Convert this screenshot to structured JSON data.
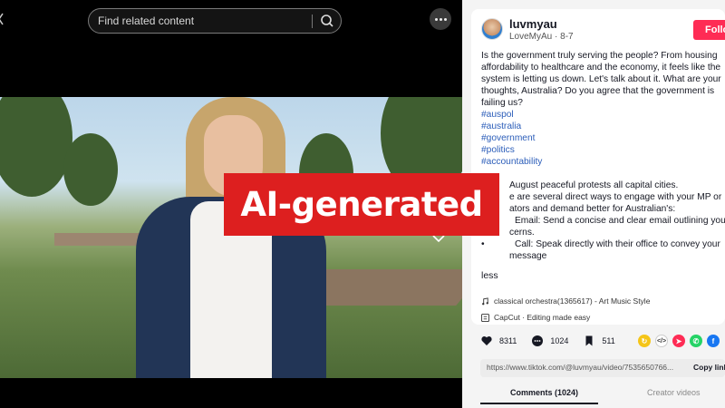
{
  "search": {
    "placeholder": "Find related content"
  },
  "overlay": {
    "badge_text": "AI-generated"
  },
  "post": {
    "username": "luvmyau",
    "handle_date": "LoveMyAu · 8-7",
    "follow_label": "Follow",
    "caption": "Is the government truly serving the people? From housing affordability to healthcare and the economy, it feels like the system is letting us down. Let's talk about it. What are your thoughts, Australia? Do you agree that the government is failing us?",
    "hashtags": [
      "#auspol",
      "#australia",
      "#government",
      "#politics",
      "#accountability"
    ],
    "body_lines": [
      "August peaceful protests all capital cities.",
      "e are several direct ways to engage with your MP or",
      "ators and demand better for Australian's:",
      "Email: Send a concise and clear email outlining your",
      "cerns.",
      "Call: Speak directly with their office to convey your",
      "message"
    ],
    "less_label": "less",
    "music": "classical orchestra(1365617) - Art Music Style",
    "capcut": "CapCut · Editing made easy"
  },
  "stats": {
    "likes": "8311",
    "comments": "1024",
    "saves": "511"
  },
  "share": {
    "url": "https://www.tiktok.com/@luvmyau/video/7535650766...",
    "copy_label": "Copy link"
  },
  "tabs": {
    "comments": "Comments (1024)",
    "creator": "Creator videos"
  },
  "colors": {
    "accent": "#fe2c55",
    "badge": "#dd1f1f",
    "hashtag": "#2b5db9"
  }
}
